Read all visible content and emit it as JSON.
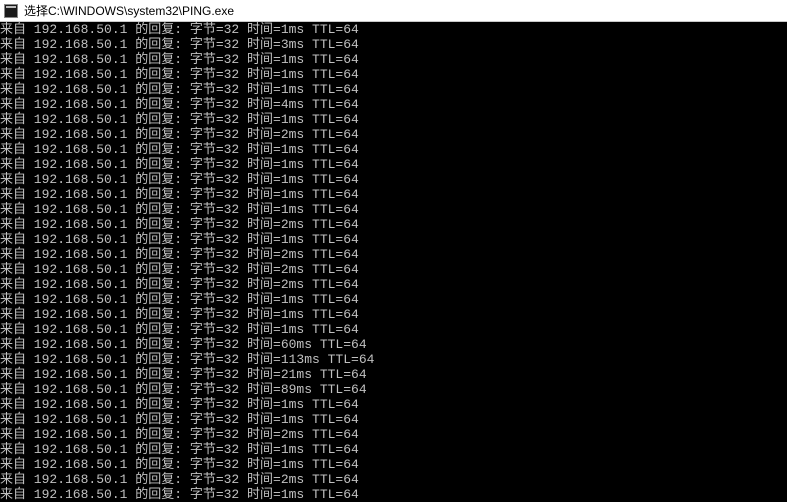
{
  "window": {
    "title": "选择C:\\WINDOWS\\system32\\PING.exe"
  },
  "ping": {
    "prefix": "来自 ",
    "ip": "192.168.50.1",
    "reply_label": " 的回复: ",
    "bytes_label": "字节=",
    "bytes": 32,
    "time_label": " 时间=",
    "time_unit": "ms ",
    "ttl_label": "TTL=",
    "ttl": 64,
    "times_ms": [
      1,
      3,
      1,
      1,
      1,
      4,
      1,
      2,
      1,
      1,
      1,
      1,
      1,
      2,
      1,
      2,
      2,
      2,
      1,
      1,
      1,
      60,
      113,
      21,
      89,
      1,
      1,
      2,
      1,
      1,
      2,
      1
    ]
  }
}
